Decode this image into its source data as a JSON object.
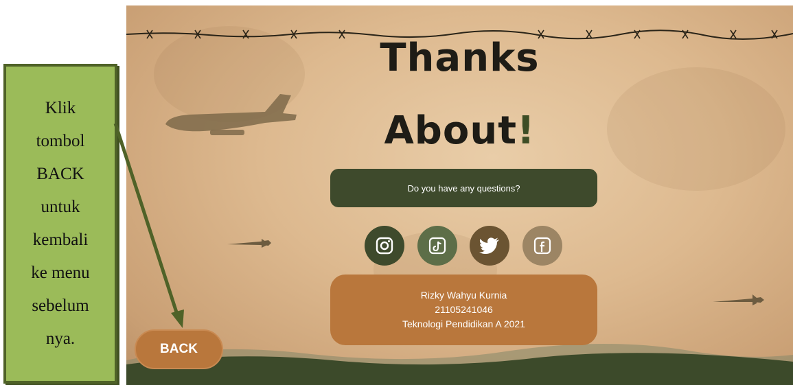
{
  "callout": {
    "lines": [
      "Klik",
      "tombol",
      "BACK",
      "untuk",
      "kembali",
      "ke menu",
      "sebelum",
      "nya."
    ]
  },
  "screen": {
    "title_line1": "Thanks",
    "title_line2_main": "About",
    "title_line2_accent": "!",
    "question_text": "Do you have any questions?",
    "social_icons": [
      {
        "name": "instagram-icon",
        "color": "#3e4a2c"
      },
      {
        "name": "tiktok-icon",
        "color": "#5d6e48"
      },
      {
        "name": "twitter-icon",
        "color": "#6b5432"
      },
      {
        "name": "facebook-icon",
        "color": "#9c8564"
      }
    ],
    "info": {
      "name": "Rizky Wahyu Kurnia",
      "id": "21105241046",
      "program": "Teknologi Pendidikan A 2021"
    },
    "back_label": "BACK"
  },
  "colors": {
    "dark_olive": "#3e4a2c",
    "accent_brown": "#b9773c",
    "callout_green": "#9bbb59",
    "arrow_green": "#4f6228"
  }
}
